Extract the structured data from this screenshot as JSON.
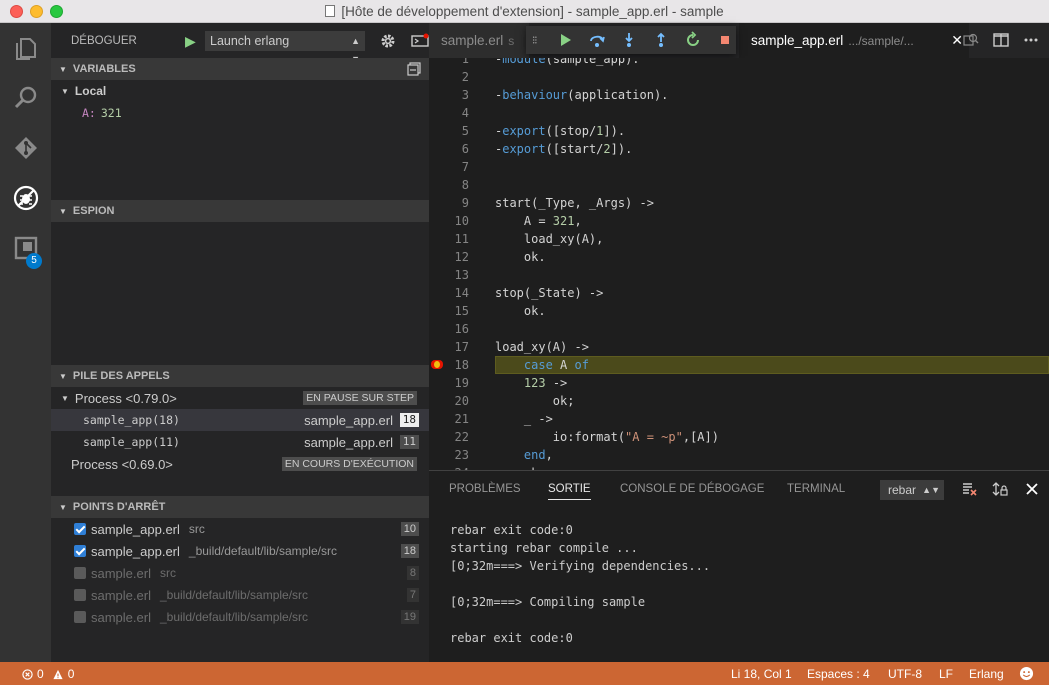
{
  "window": {
    "title": "[Hôte de développement d'extension] - sample_app.erl - sample"
  },
  "activity_bar": {
    "extensions_badge": "5"
  },
  "sidebar": {
    "title": "DÉBOGUER",
    "launch_config": "Launch erlang",
    "variables": {
      "header": "VARIABLES",
      "scope": "Local",
      "items": [
        {
          "name": "A:",
          "value": "321"
        }
      ]
    },
    "watch": {
      "header": "ESPION"
    },
    "call_stack": {
      "header": "PILE DES APPELS",
      "processes": [
        {
          "name": "Process <0.79.0>",
          "state": "EN PAUSE SUR STEP",
          "frames": [
            {
              "name": "sample_app(18)",
              "file": "sample_app.erl",
              "line": "18"
            },
            {
              "name": "sample_app(11)",
              "file": "sample_app.erl",
              "line": "11"
            }
          ]
        },
        {
          "name": "Process <0.69.0>",
          "state": "EN COURS D'EXÉCUTION"
        }
      ]
    },
    "breakpoints": {
      "header": "POINTS D'ARRÊT",
      "items": [
        {
          "file": "sample_app.erl",
          "path": "src",
          "line": "10"
        },
        {
          "file": "sample_app.erl",
          "path": "_build/default/lib/sample/src",
          "line": "18"
        },
        {
          "file": "sample.erl",
          "path": "src",
          "line": "8"
        },
        {
          "file": "sample.erl",
          "path": "_build/default/lib/sample/src",
          "line": "7"
        },
        {
          "file": "sample.erl",
          "path": "_build/default/lib/sample/src",
          "line": "19"
        }
      ]
    }
  },
  "editor": {
    "tabs": [
      {
        "label": "sample.erl",
        "desc": "s"
      },
      {
        "label": "sample_app.erl",
        "desc": ".../sample/..."
      }
    ],
    "lines": [
      {
        "n": "1",
        "text": "-module(sample_app)."
      },
      {
        "n": "2",
        "text": ""
      },
      {
        "n": "3",
        "text": "-behaviour(application)."
      },
      {
        "n": "4",
        "text": ""
      },
      {
        "n": "5",
        "text": "-export([stop/1])."
      },
      {
        "n": "6",
        "text": "-export([start/2])."
      },
      {
        "n": "7",
        "text": ""
      },
      {
        "n": "8",
        "text": ""
      },
      {
        "n": "9",
        "text": "start(_Type, _Args) ->"
      },
      {
        "n": "10",
        "text": "    A = 321,"
      },
      {
        "n": "11",
        "text": "    load_xy(A),"
      },
      {
        "n": "12",
        "text": "    ok."
      },
      {
        "n": "13",
        "text": ""
      },
      {
        "n": "14",
        "text": "stop(_State) ->"
      },
      {
        "n": "15",
        "text": "    ok."
      },
      {
        "n": "16",
        "text": ""
      },
      {
        "n": "17",
        "text": "load_xy(A) ->"
      },
      {
        "n": "18",
        "text": "    case A of"
      },
      {
        "n": "19",
        "text": "    123 ->"
      },
      {
        "n": "20",
        "text": "        ok;"
      },
      {
        "n": "21",
        "text": "    _ ->"
      },
      {
        "n": "22",
        "text": "        io:format(\"A = ~p\",[A])"
      },
      {
        "n": "23",
        "text": "    end,"
      },
      {
        "n": "24",
        "text": "    ok."
      }
    ]
  },
  "panel": {
    "tabs": [
      "PROBLÈMES",
      "SORTIE",
      "CONSOLE DE DÉBOGAGE",
      "TERMINAL"
    ],
    "output_channel": "rebar",
    "output": [
      "rebar exit code:0",
      "starting rebar compile ...",
      "[0;32m===> Verifying dependencies...",
      "",
      "[0;32m===> Compiling sample",
      "",
      "rebar exit code:0"
    ]
  },
  "statusbar": {
    "errors": "0",
    "warnings": "0",
    "position": "Li 18, Col 1",
    "spaces": "Espaces : 4",
    "encoding": "UTF-8",
    "eol": "LF",
    "language": "Erlang"
  },
  "colors": {
    "statusbar_debug": "#cc6633",
    "accent": "#007acc",
    "breakpoint": "#e51400"
  }
}
